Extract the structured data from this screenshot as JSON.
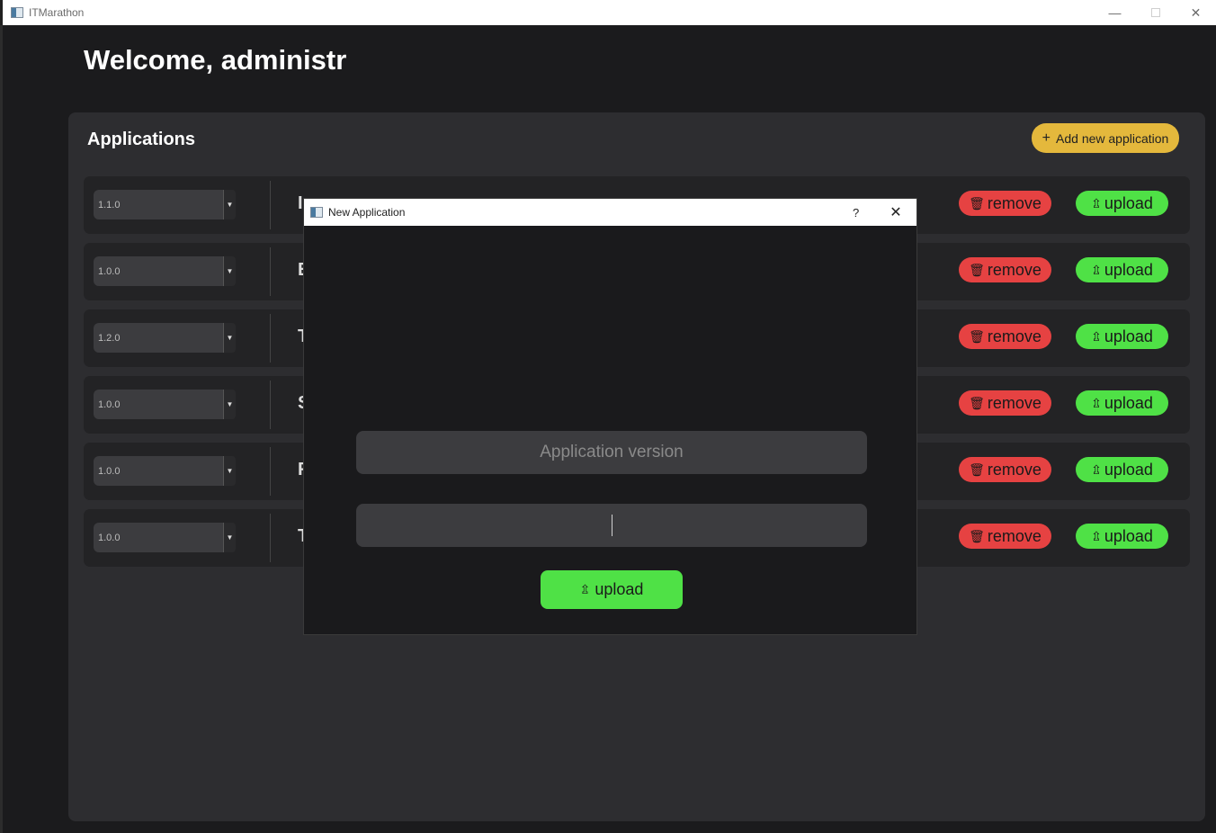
{
  "window": {
    "title": "ITMarathon",
    "minimize_glyph": "—",
    "close_glyph": "✕"
  },
  "welcome": "Welcome, administr",
  "panel": {
    "title": "Applications",
    "add_button": "Add new application",
    "add_icon": "+"
  },
  "rows": [
    {
      "version": "1.1.0",
      "name_initial": "I",
      "remove": "remove",
      "upload": "upload"
    },
    {
      "version": "1.0.0",
      "name_initial": "E",
      "remove": "remove",
      "upload": "upload"
    },
    {
      "version": "1.2.0",
      "name_initial": "T",
      "remove": "remove",
      "upload": "upload"
    },
    {
      "version": "1.0.0",
      "name_initial": "S",
      "remove": "remove",
      "upload": "upload"
    },
    {
      "version": "1.0.0",
      "name_initial": "F",
      "remove": "remove",
      "upload": "upload"
    },
    {
      "version": "1.0.0",
      "name_initial": "T",
      "remove": "remove",
      "upload": "upload"
    }
  ],
  "icons": {
    "trash": "🗑",
    "upload": "⇫",
    "dropdown": "▼"
  },
  "dialog": {
    "title": "New Application",
    "help": "?",
    "close": "✕",
    "version_placeholder": "Application version",
    "file_value": "",
    "upload_button": "upload"
  },
  "colors": {
    "remove": "#e64242",
    "upload": "#4fe146",
    "add": "#e4b83c"
  }
}
